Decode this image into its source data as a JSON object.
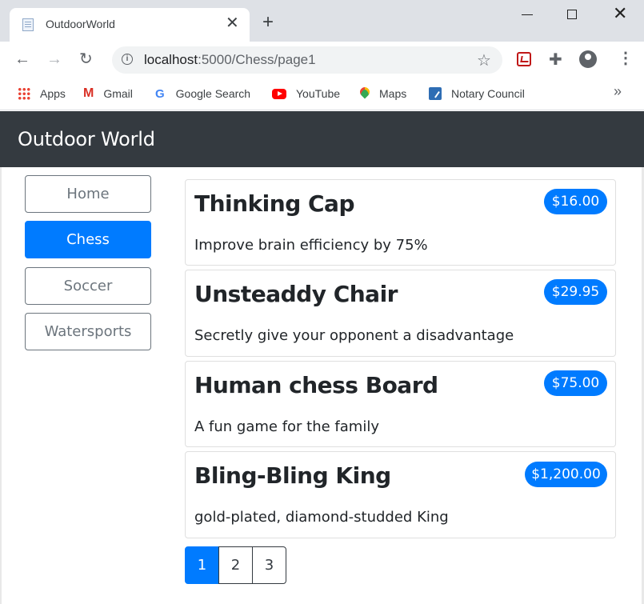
{
  "browser": {
    "tab_title": "OutdoorWorld",
    "url_host": "localhost",
    "url_path": ":5000/Chess/page1",
    "bookmarks": [
      {
        "label": "Apps",
        "icon": "apps-grid-icon"
      },
      {
        "label": "Gmail",
        "icon": "gmail-icon"
      },
      {
        "label": "Google Search",
        "icon": "google-icon"
      },
      {
        "label": "YouTube",
        "icon": "youtube-icon"
      },
      {
        "label": "Maps",
        "icon": "maps-icon"
      },
      {
        "label": "Notary Council",
        "icon": "notary-icon"
      }
    ],
    "bookmarks_more": "»"
  },
  "navbar": {
    "brand": "Outdoor World"
  },
  "sidebar": {
    "items": [
      {
        "label": "Home",
        "active": false
      },
      {
        "label": "Chess",
        "active": true
      },
      {
        "label": "Soccer",
        "active": false
      },
      {
        "label": "Watersports",
        "active": false
      }
    ]
  },
  "products": [
    {
      "name": "Thinking Cap",
      "price": "$16.00",
      "description": "Improve brain efficiency by 75%"
    },
    {
      "name": "Unsteaddy Chair",
      "price": "$29.95",
      "description": "Secretly give your opponent a disadvantage"
    },
    {
      "name": "Human chess Board",
      "price": "$75.00",
      "description": "A fun game for the family"
    },
    {
      "name": "Bling-Bling King",
      "price": "$1,200.00",
      "description": "gold-plated, diamond-studded King"
    }
  ],
  "pagination": {
    "pages": [
      "1",
      "2",
      "3"
    ],
    "current": "1"
  },
  "colors": {
    "primary": "#007bff",
    "navbar": "#343a40",
    "secondary": "#6c757d"
  }
}
